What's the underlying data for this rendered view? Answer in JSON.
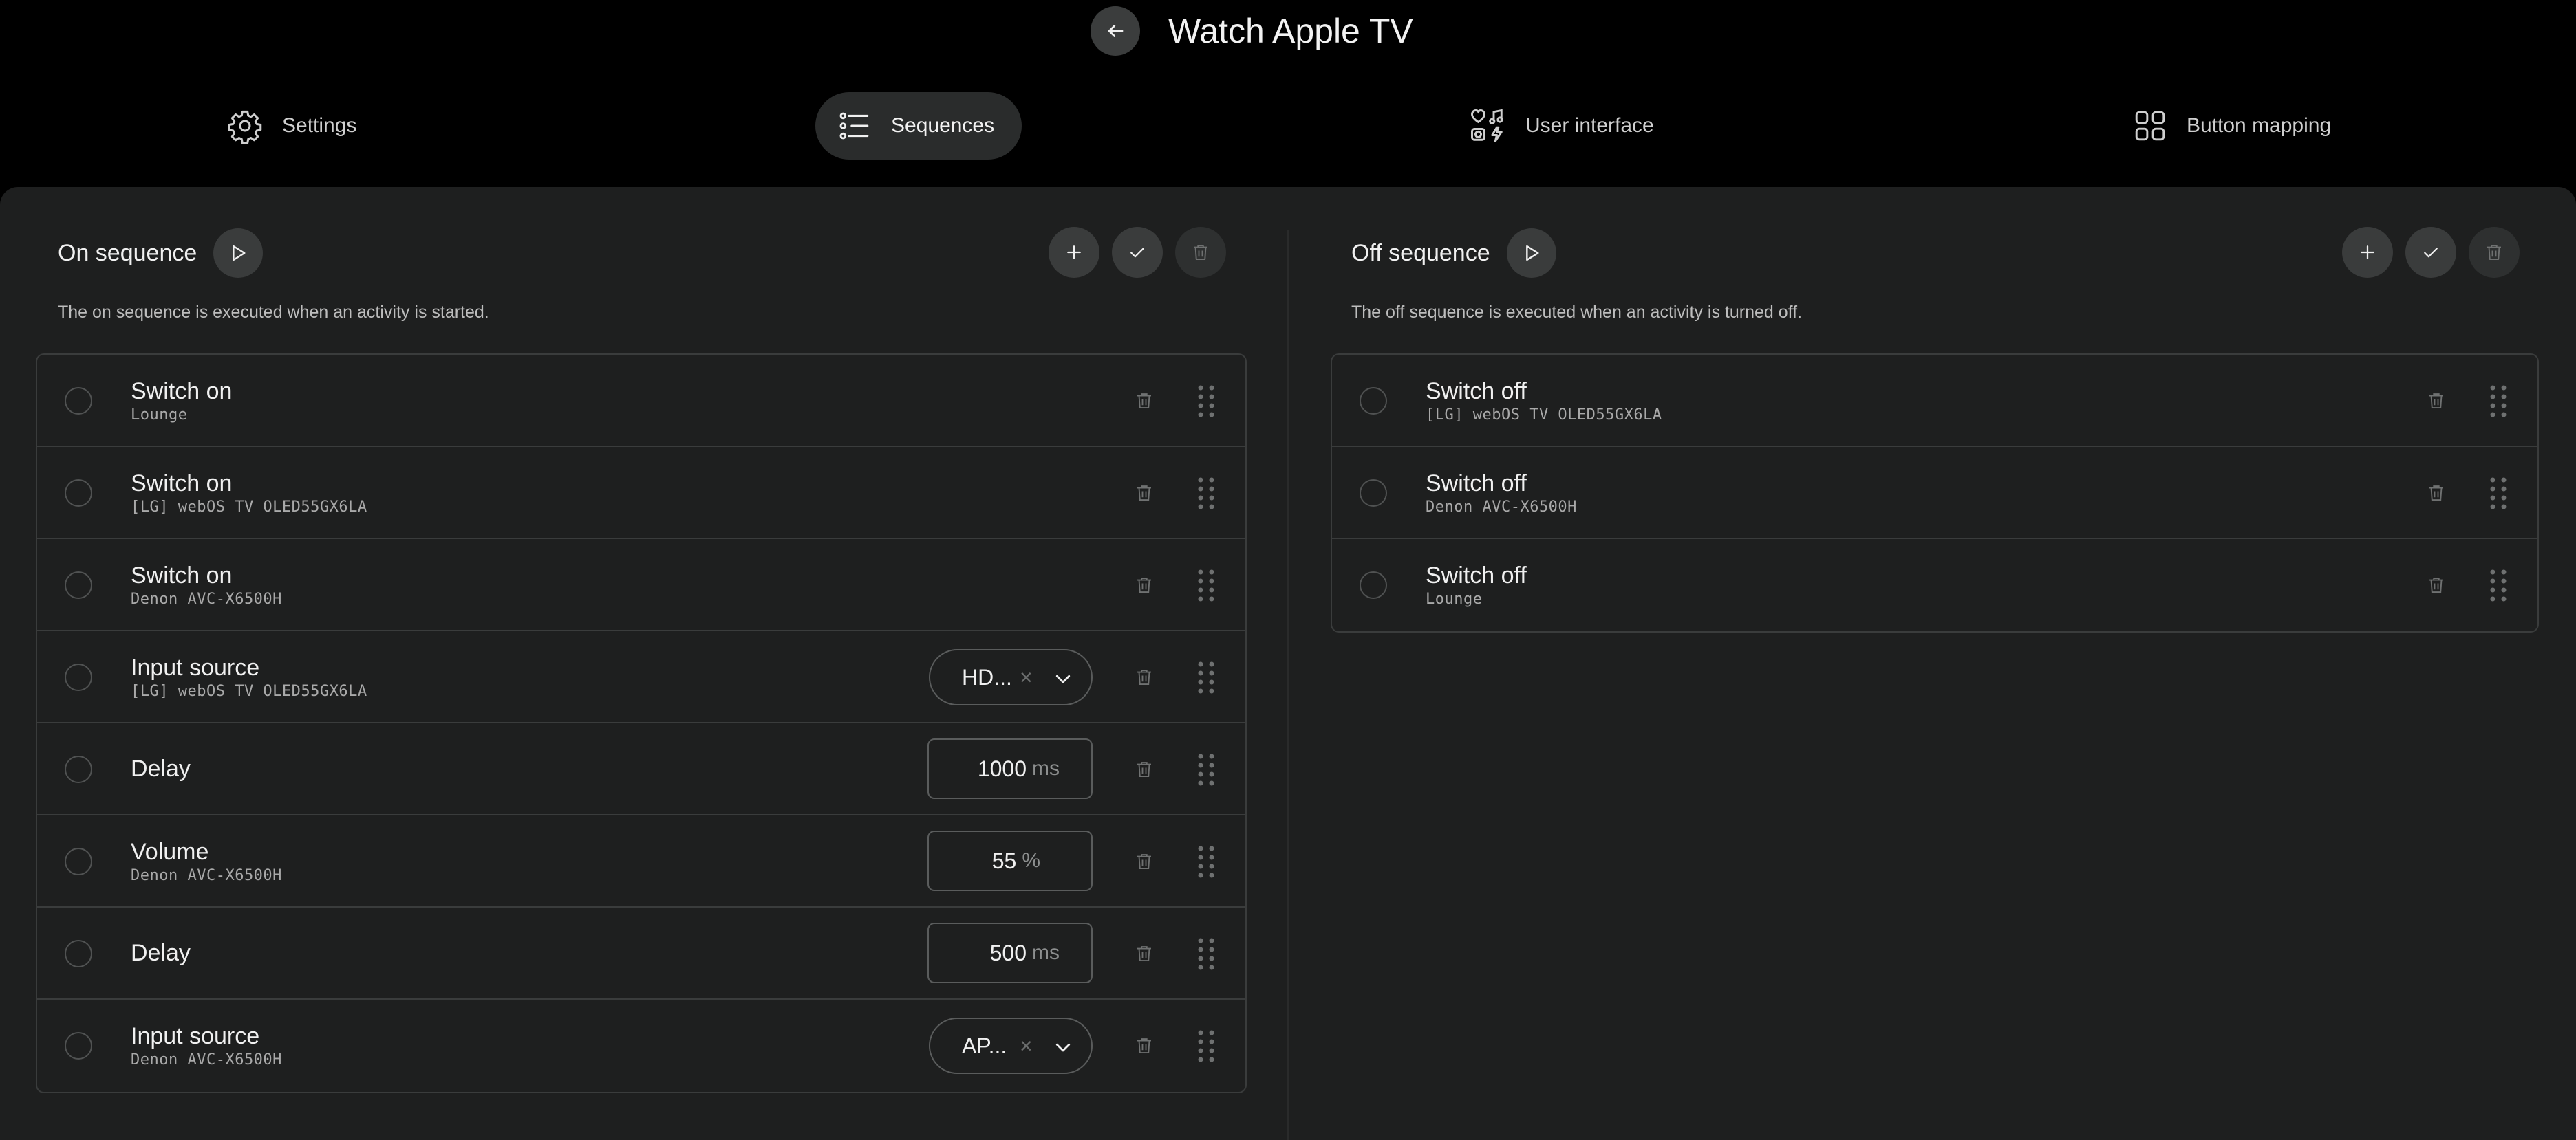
{
  "header": {
    "title": "Watch Apple TV"
  },
  "tabs": [
    {
      "label": "Settings"
    },
    {
      "label": "Sequences"
    },
    {
      "label": "User interface"
    },
    {
      "label": "Button mapping"
    }
  ],
  "on_sequence": {
    "title": "On sequence",
    "description": "The on sequence is executed when an activity is started.",
    "items": [
      {
        "title": "Switch on",
        "sub": "Lounge"
      },
      {
        "title": "Switch on",
        "sub": "[LG] webOS TV OLED55GX6LA"
      },
      {
        "title": "Switch on",
        "sub": "Denon AVC-X6500H"
      },
      {
        "title": "Input source",
        "sub": "[LG] webOS TV OLED55GX6LA",
        "select": "HD...",
        "clear": "×"
      },
      {
        "title": "Delay",
        "value": "1000",
        "unit": "ms"
      },
      {
        "title": "Volume",
        "sub": "Denon AVC-X6500H",
        "value": "55",
        "unit": "%"
      },
      {
        "title": "Delay",
        "value": "500",
        "unit": "ms"
      },
      {
        "title": "Input source",
        "sub": "Denon AVC-X6500H",
        "select": "AP...",
        "clear": "×"
      }
    ]
  },
  "off_sequence": {
    "title": "Off sequence",
    "description": "The off sequence is executed when an activity is turned off.",
    "items": [
      {
        "title": "Switch off",
        "sub": "[LG] webOS TV OLED55GX6LA"
      },
      {
        "title": "Switch off",
        "sub": "Denon AVC-X6500H"
      },
      {
        "title": "Switch off",
        "sub": "Lounge"
      }
    ]
  },
  "icons": {
    "back": "arrow-left-icon",
    "settings": "gear-icon",
    "sequences": "list-icon",
    "user_interface": "ui-widgets-icon",
    "button_mapping": "grid-icon",
    "play": "play-icon",
    "add": "plus-icon",
    "confirm": "check-icon",
    "delete": "trash-icon",
    "drag": "drag-handle-icon",
    "dropdown": "chevron-down-icon"
  },
  "colors": {
    "background": "#000000",
    "panel": "#1e1f1f",
    "button": "#3a3c3c",
    "border": "#3a3c3c"
  }
}
